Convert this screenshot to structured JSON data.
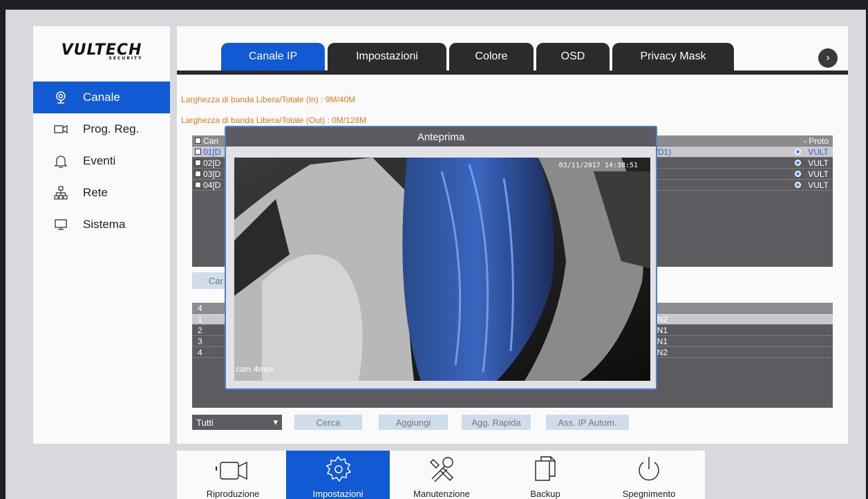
{
  "sidebar": {
    "logo": "VULTECH",
    "logo_sub": "SECURITY",
    "items": [
      {
        "label": "Canale",
        "icon": "webcam-icon"
      },
      {
        "label": "Prog. Reg.",
        "icon": "video-camera-icon"
      },
      {
        "label": "Eventi",
        "icon": "bell-icon"
      },
      {
        "label": "Rete",
        "icon": "network-icon"
      },
      {
        "label": "Sistema",
        "icon": "monitor-icon"
      }
    ]
  },
  "tabs": [
    "Canale IP",
    "Impostazioni",
    "Colore",
    "OSD",
    "Privacy Mask"
  ],
  "bandwidth": {
    "in": "Larghezza di banda Libera/Totale (In) : 9M/40M",
    "out": "Larghezza di banda Libera/Totale (Out) : 0M/128M"
  },
  "channel_table": {
    "header_left": "Can",
    "header_right": "- Proto",
    "rows": [
      {
        "ch": "01[D",
        "mid": "9)/D1)",
        "proto": "VULT"
      },
      {
        "ch": "02[D",
        "mid": "",
        "proto": "VULT"
      },
      {
        "ch": "03[D",
        "mid": "",
        "proto": "VULT"
      },
      {
        "ch": "04[D",
        "mid": "",
        "proto": "VULT"
      }
    ]
  },
  "search_button_partial": "Car",
  "device_table": {
    "header": "4",
    "rows": [
      {
        "n": "1",
        "iface": "LAN2"
      },
      {
        "n": "2",
        "iface": "LAN1"
      },
      {
        "n": "3",
        "iface": "LAN1"
      },
      {
        "n": "4",
        "iface": "LAN2"
      }
    ]
  },
  "actions": {
    "filter": "Tutti",
    "cerca": "Cerca",
    "aggiungi": "Aggiungi",
    "rapida": "Agg. Rapida",
    "autom": "Ass. IP Autom."
  },
  "preview": {
    "title": "Anteprima",
    "timestamp": "03/11/2017 14:38:51",
    "camera_name": "cam 4mpx"
  },
  "bottom": [
    "Riproduzione",
    "Impostazioni",
    "Manutenzione",
    "Backup",
    "Spegnimento"
  ]
}
